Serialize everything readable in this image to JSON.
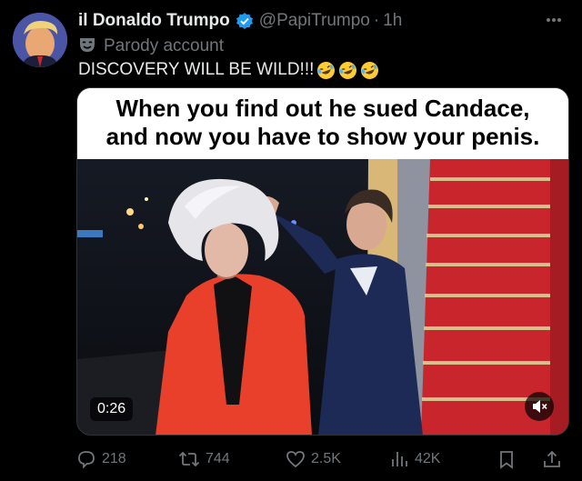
{
  "post": {
    "display_name": "il Donaldo Trumpo",
    "handle": "@PapiTrumpo",
    "separator": "·",
    "time": "1h",
    "parody_label": "Parody account",
    "text": "DISCOVERY WILL BE WILD!!!",
    "emoji": [
      "rolling-laughing-emoji",
      "rolling-laughing-emoji",
      "rolling-laughing-emoji"
    ]
  },
  "media": {
    "caption_line1": "When you find out he sued Candace,",
    "caption_line2": "and now you have to show your penis.",
    "duration": "0:26"
  },
  "actions": {
    "replies": "218",
    "reposts": "744",
    "likes": "2.5K",
    "views": "42K"
  },
  "colors": {
    "background": "#000000",
    "primary_text": "#e7e9ea",
    "secondary_text": "#71767b",
    "verified_blue": "#1d9bf0",
    "red_carpet": "#c8262c",
    "suit_red": "#e8402a"
  }
}
